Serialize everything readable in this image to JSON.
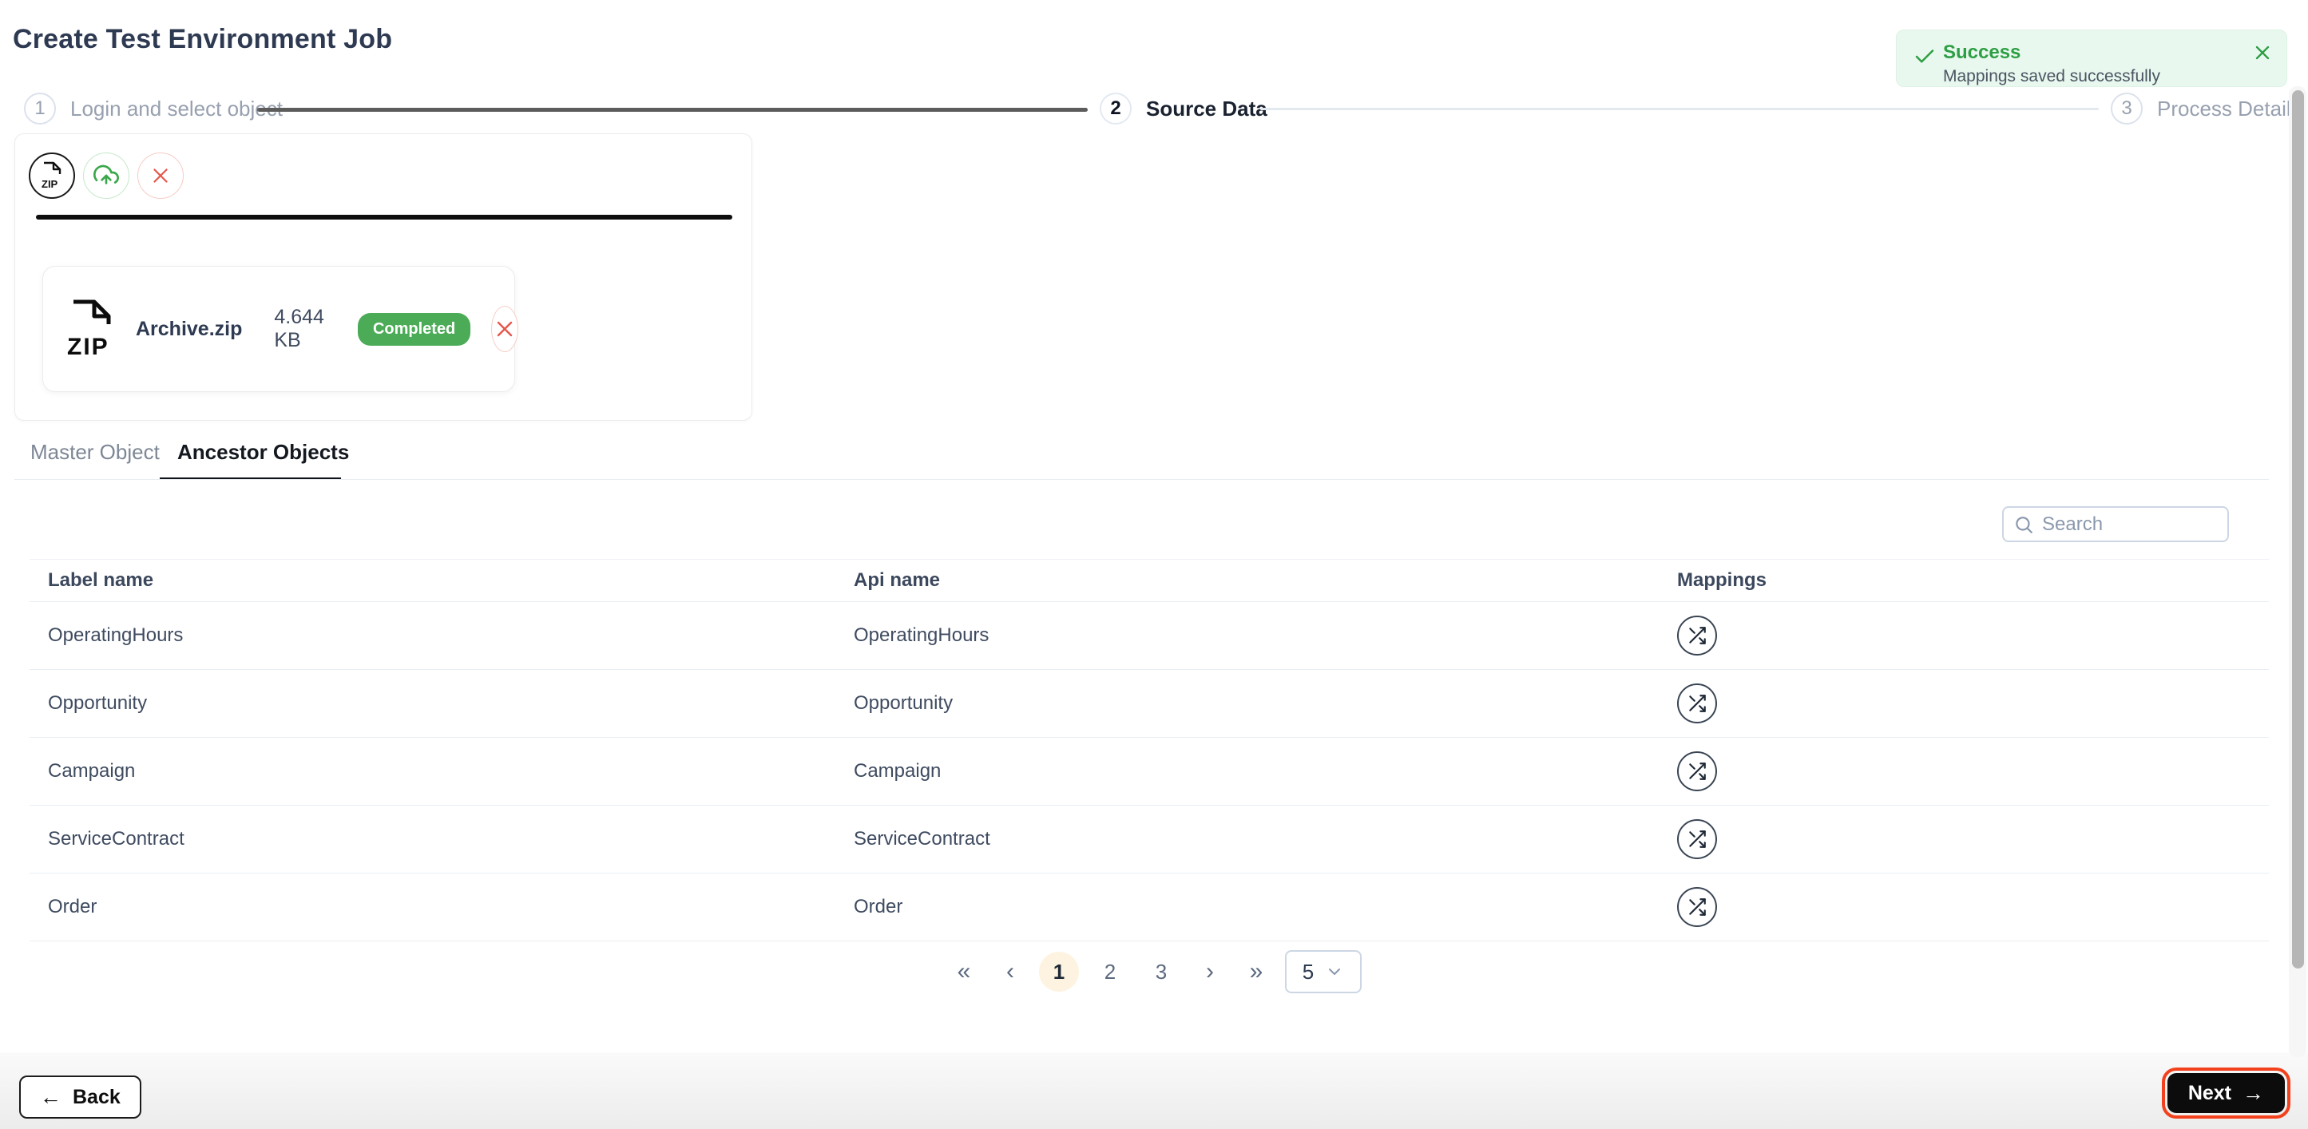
{
  "page": {
    "title": "Create Test Environment Job"
  },
  "toast": {
    "title": "Success",
    "message": "Mappings saved successfully",
    "title_color": "#2e9e44",
    "background": "#e9f8ee"
  },
  "stepper": {
    "steps": [
      {
        "num": "1",
        "label": "Login and select object",
        "state": "completed"
      },
      {
        "num": "2",
        "label": "Source Data",
        "state": "active"
      },
      {
        "num": "3",
        "label": "Process Details",
        "state": "upcoming"
      }
    ]
  },
  "upload": {
    "zip_icon_label": "ZIP",
    "file": {
      "name": "Archive.zip",
      "size": "4.644 KB",
      "status": "Completed"
    },
    "status_color": "#4cab57",
    "progress_color": "#0e0e0e"
  },
  "tabs": [
    {
      "label": "Master Object",
      "active": false
    },
    {
      "label": "Ancestor Objects",
      "active": true
    }
  ],
  "search": {
    "placeholder": "Search"
  },
  "table": {
    "columns": [
      "Label name",
      "Api name",
      "Mappings"
    ],
    "rows": [
      {
        "label": "OperatingHours",
        "api": "OperatingHours"
      },
      {
        "label": "Opportunity",
        "api": "Opportunity"
      },
      {
        "label": "Campaign",
        "api": "Campaign"
      },
      {
        "label": "ServiceContract",
        "api": "ServiceContract"
      },
      {
        "label": "Order",
        "api": "Order"
      }
    ]
  },
  "pagination": {
    "first": "«",
    "prev": "‹",
    "next": "›",
    "last": "»",
    "pages": [
      "1",
      "2",
      "3"
    ],
    "current": "1",
    "page_size": "5",
    "active_bg": "#fdf3e0"
  },
  "footer": {
    "back_label": "Back",
    "back_arrow": "←",
    "next_label": "Next",
    "next_arrow": "→",
    "next_ring_color": "#f2411c"
  }
}
